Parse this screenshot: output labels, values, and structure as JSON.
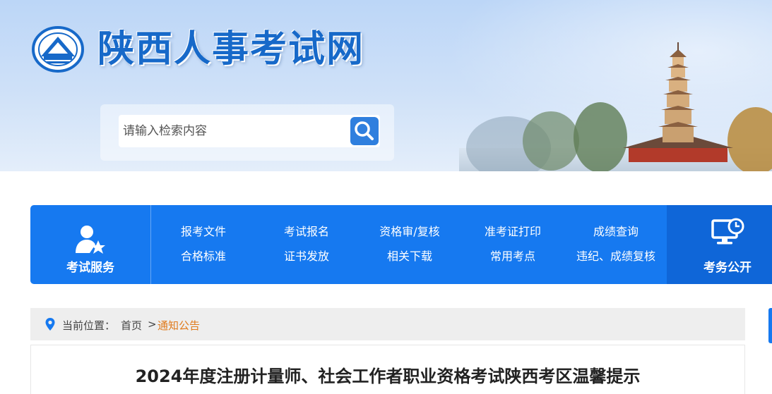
{
  "site": {
    "title": "陕西人事考试网"
  },
  "search": {
    "placeholder": "请输入检索内容"
  },
  "nav": {
    "left_label": "考试服务",
    "links": [
      [
        "报考文件",
        "考试报名",
        "资格审/复核",
        "准考证打印",
        "成绩查询"
      ],
      [
        "合格标准",
        "证书发放",
        "相关下载",
        "常用考点",
        "违纪、成绩复核"
      ]
    ],
    "right_label": "考务公开"
  },
  "breadcrumb": {
    "prefix": "当前位置：",
    "home": "首页",
    "separator": ">",
    "current": "通知公告"
  },
  "article": {
    "title": "2024年度注册计量师、社会工作者职业资格考试陕西考区温馨提示"
  },
  "colors": {
    "brand_blue": "#1679f0",
    "dark_blue": "#0f66d8",
    "title_blue": "#1769c9",
    "accent_orange": "#e07a1c"
  }
}
